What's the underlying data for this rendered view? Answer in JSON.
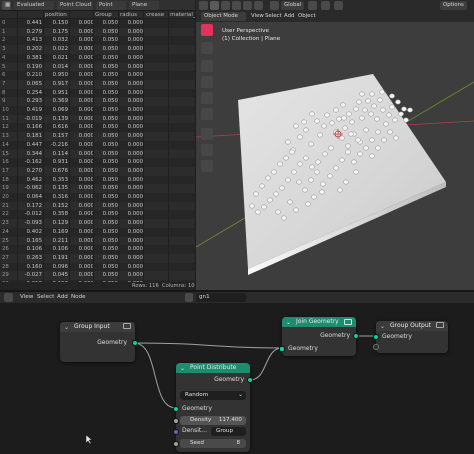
{
  "spreadsheet": {
    "header": {
      "evaluated": "Evaluated",
      "component": "Point Cloud",
      "domain": "Point",
      "object": "Plane"
    },
    "columns": [
      "position",
      "Group",
      "radius",
      "crease",
      "material_in"
    ],
    "rows": [
      [
        "0",
        "0.441",
        "0.150",
        "0.000",
        "0.050",
        "0.000"
      ],
      [
        "1",
        "0.279",
        "0.175",
        "0.000",
        "0.050",
        "0.000"
      ],
      [
        "2",
        "0.413",
        "0.032",
        "0.000",
        "0.050",
        "0.000"
      ],
      [
        "3",
        "0.202",
        "0.022",
        "0.000",
        "0.050",
        "0.000"
      ],
      [
        "4",
        "0.381",
        "0.021",
        "0.000",
        "0.050",
        "0.000"
      ],
      [
        "5",
        "0.190",
        "0.014",
        "0.000",
        "0.050",
        "0.000"
      ],
      [
        "6",
        "0.210",
        "0.950",
        "0.000",
        "0.050",
        "0.000"
      ],
      [
        "7",
        "0.065",
        "0.917",
        "0.000",
        "0.050",
        "0.000"
      ],
      [
        "8",
        "0.254",
        "0.951",
        "0.000",
        "0.050",
        "0.000"
      ],
      [
        "9",
        "0.293",
        "0.369",
        "0.000",
        "0.050",
        "0.000"
      ],
      [
        "10",
        "0.419",
        "0.069",
        "0.000",
        "0.050",
        "0.000"
      ],
      [
        "11",
        "-0.019",
        "0.139",
        "0.000",
        "0.050",
        "0.000"
      ],
      [
        "12",
        "0.166",
        "0.616",
        "0.000",
        "0.050",
        "0.000"
      ],
      [
        "13",
        "0.181",
        "0.157",
        "0.000",
        "0.050",
        "0.000"
      ],
      [
        "14",
        "0.447",
        "-0.216",
        "0.000",
        "0.050",
        "0.000"
      ],
      [
        "15",
        "0.344",
        "0.114",
        "0.000",
        "0.050",
        "0.000"
      ],
      [
        "16",
        "-0.162",
        "0.931",
        "0.000",
        "0.050",
        "0.000"
      ],
      [
        "17",
        "0.270",
        "0.676",
        "0.000",
        "0.050",
        "0.000"
      ],
      [
        "18",
        "0.462",
        "0.353",
        "0.000",
        "0.050",
        "0.000"
      ],
      [
        "19",
        "-0.062",
        "0.135",
        "0.000",
        "0.050",
        "0.000"
      ],
      [
        "20",
        "0.064",
        "0.316",
        "0.000",
        "0.050",
        "0.000"
      ],
      [
        "21",
        "0.172",
        "0.152",
        "0.000",
        "0.050",
        "0.000"
      ],
      [
        "22",
        "-0.012",
        "0.358",
        "0.000",
        "0.050",
        "0.000"
      ],
      [
        "23",
        "-0.093",
        "0.129",
        "0.000",
        "0.050",
        "0.000"
      ],
      [
        "24",
        "0.402",
        "0.169",
        "0.000",
        "0.050",
        "0.000"
      ],
      [
        "25",
        "0.165",
        "0.211",
        "0.000",
        "0.050",
        "0.000"
      ],
      [
        "26",
        "0.106",
        "0.106",
        "0.000",
        "0.050",
        "0.000"
      ],
      [
        "27",
        "0.263",
        "0.191",
        "0.000",
        "0.050",
        "0.000"
      ],
      [
        "28",
        "0.160",
        "0.096",
        "0.000",
        "0.050",
        "0.000"
      ],
      [
        "29",
        "-0.027",
        "0.045",
        "0.000",
        "0.050",
        "0.000"
      ],
      [
        "30",
        "0.018",
        "0.153",
        "0.000",
        "0.050",
        "0.000"
      ]
    ],
    "footer": {
      "rows": "Rows: 116",
      "columns": "Columns: 10"
    }
  },
  "viewport": {
    "header": {
      "mode": "Object Mode",
      "view": "View",
      "select": "Select",
      "add": "Add",
      "object": "Object",
      "orientation": "Global",
      "options": "Options"
    },
    "info_line1": "User Perspective",
    "info_line2": "(1) Collection | Plane",
    "colors": {
      "background": "#3d3d3d",
      "plane": "#d8d8d8",
      "axis_red": "#b3404a",
      "axis_green": "#6a8f2c",
      "active_tool": "#e0325a"
    }
  },
  "node_editor": {
    "header": {
      "view": "View",
      "select": "Select",
      "add": "Add",
      "node": "Node",
      "tree_name": "gn1"
    },
    "group_input": {
      "title": "Group Input",
      "output": "Geometry"
    },
    "point_distribute": {
      "title": "Point Distribute",
      "output": "Geometry",
      "mode": "Random",
      "input_geometry": "Geometry",
      "density_label": "Density",
      "density_value": "117.400",
      "density_attr_label": "Densit...",
      "density_attr_value": "Group",
      "seed_label": "Seed",
      "seed_value": "8"
    },
    "join_geometry": {
      "title": "Join Geometry",
      "output": "Geometry",
      "input": "Geometry"
    },
    "group_output": {
      "title": "Group Output",
      "input": "Geometry"
    },
    "colors": {
      "geometry_socket": "#00d6a3",
      "header_geometry": "#1e8c6e",
      "header_input": "#3c3c3c"
    }
  }
}
